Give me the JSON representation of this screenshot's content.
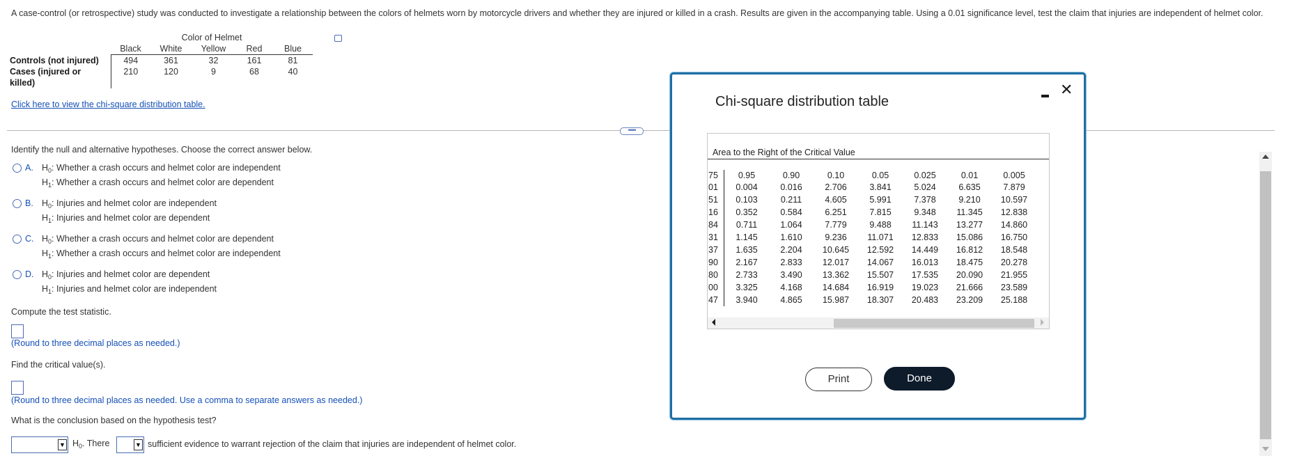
{
  "question": "A case-control (or retrospective) study was conducted to investigate a relationship between the colors of helmets worn by motorcycle drivers and whether they are injured or killed in a crash. Results are given in the accompanying table. Using a 0.01 significance level, test the claim that injuries are independent of helmet color.",
  "data_table": {
    "group_title": "Color of Helmet",
    "columns": [
      "Black",
      "White",
      "Yellow",
      "Red",
      "Blue"
    ],
    "rows": [
      {
        "label": "Controls (not injured)",
        "values": [
          "494",
          "361",
          "32",
          "161",
          "81"
        ]
      },
      {
        "label": "Cases (injured or killed)",
        "values": [
          "210",
          "120",
          "9",
          "68",
          "40"
        ]
      }
    ]
  },
  "chi_link": "Click here to view the chi-square distribution table.",
  "identify_prompt": "Identify the null and alternative hypotheses. Choose the correct answer below.",
  "choices": [
    {
      "letter": "A.",
      "h0": "Whether a crash occurs and helmet color are independent",
      "h1": "Whether a crash occurs and helmet color are dependent"
    },
    {
      "letter": "B.",
      "h0": "Injuries and helmet color are independent",
      "h1": "Injuries and helmet color are dependent"
    },
    {
      "letter": "C.",
      "h0": "Whether a crash occurs and helmet color are dependent",
      "h1": "Whether a crash occurs and helmet color are independent"
    },
    {
      "letter": "D.",
      "h0": "Injuries and helmet color are dependent",
      "h1": "Injuries and helmet color are independent"
    }
  ],
  "h0_sym": "H",
  "h0_sub": "0",
  "h1_sub": "1",
  "compute_prompt": "Compute the test statistic.",
  "round_note_1": "(Round to three decimal places as needed.)",
  "find_prompt": "Find the critical value(s).",
  "round_note_2": "(Round to three decimal places as needed. Use a comma to separate answers as needed.)",
  "conclusion_prompt": "What is the conclusion based on the hypothesis test?",
  "conclusion_mid": ". There",
  "conclusion_tail": "sufficient evidence to warrant rejection of the claim that injuries are independent of helmet color.",
  "dropdown_arrow": "▼",
  "modal": {
    "title": "Chi-square distribution table",
    "area_label": "Area to the Right of the Critical Value",
    "headers": [
      "75",
      "0.95",
      "0.90",
      "0.10",
      "0.05",
      "0.025",
      "0.01",
      "0.005"
    ],
    "rows": [
      [
        "01",
        "0.004",
        "0.016",
        "2.706",
        "3.841",
        "5.024",
        "6.635",
        "7.879"
      ],
      [
        "51",
        "0.103",
        "0.211",
        "4.605",
        "5.991",
        "7.378",
        "9.210",
        "10.597"
      ],
      [
        "16",
        "0.352",
        "0.584",
        "6.251",
        "7.815",
        "9.348",
        "11.345",
        "12.838"
      ],
      [
        "84",
        "0.711",
        "1.064",
        "7.779",
        "9.488",
        "11.143",
        "13.277",
        "14.860"
      ],
      [
        "31",
        "1.145",
        "1.610",
        "9.236",
        "11.071",
        "12.833",
        "15.086",
        "16.750"
      ],
      [
        "37",
        "1.635",
        "2.204",
        "10.645",
        "12.592",
        "14.449",
        "16.812",
        "18.548"
      ],
      [
        "90",
        "2.167",
        "2.833",
        "12.017",
        "14.067",
        "16.013",
        "18.475",
        "20.278"
      ],
      [
        "80",
        "2.733",
        "3.490",
        "13.362",
        "15.507",
        "17.535",
        "20.090",
        "21.955"
      ],
      [
        "00",
        "3.325",
        "4.168",
        "14.684",
        "16.919",
        "19.023",
        "21.666",
        "23.589"
      ],
      [
        "47",
        "3.940",
        "4.865",
        "15.987",
        "18.307",
        "20.483",
        "23.209",
        "25.188"
      ]
    ],
    "print_label": "Print",
    "done_label": "Done",
    "close_glyph": "✕"
  }
}
